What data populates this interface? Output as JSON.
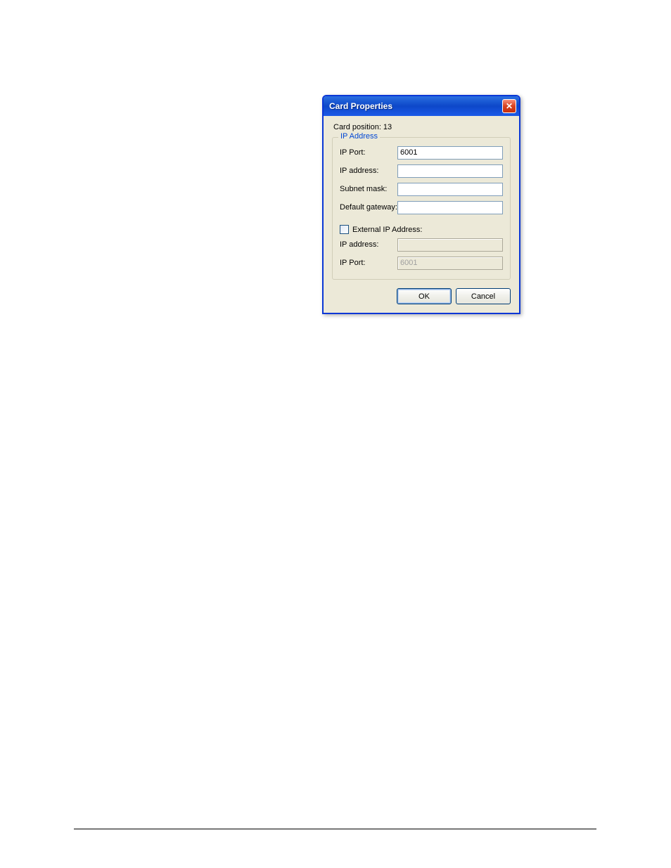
{
  "dialog": {
    "title": "Card Properties",
    "card_position_label": "Card position: 13",
    "groupbox_legend": "IP Address",
    "fields": {
      "ip_port": {
        "label": "IP Port:",
        "value": "6001"
      },
      "ip_address": {
        "label": "IP address:",
        "value": ""
      },
      "subnet_mask": {
        "label": "Subnet mask:",
        "value": ""
      },
      "default_gateway": {
        "label": "Default gateway:",
        "value": ""
      }
    },
    "external": {
      "checkbox_label": "External IP Address:",
      "checked": false,
      "ip_address": {
        "label": "IP address:",
        "value": ""
      },
      "ip_port": {
        "label": "IP Port:",
        "value": "6001"
      }
    },
    "buttons": {
      "ok": "OK",
      "cancel": "Cancel"
    }
  }
}
